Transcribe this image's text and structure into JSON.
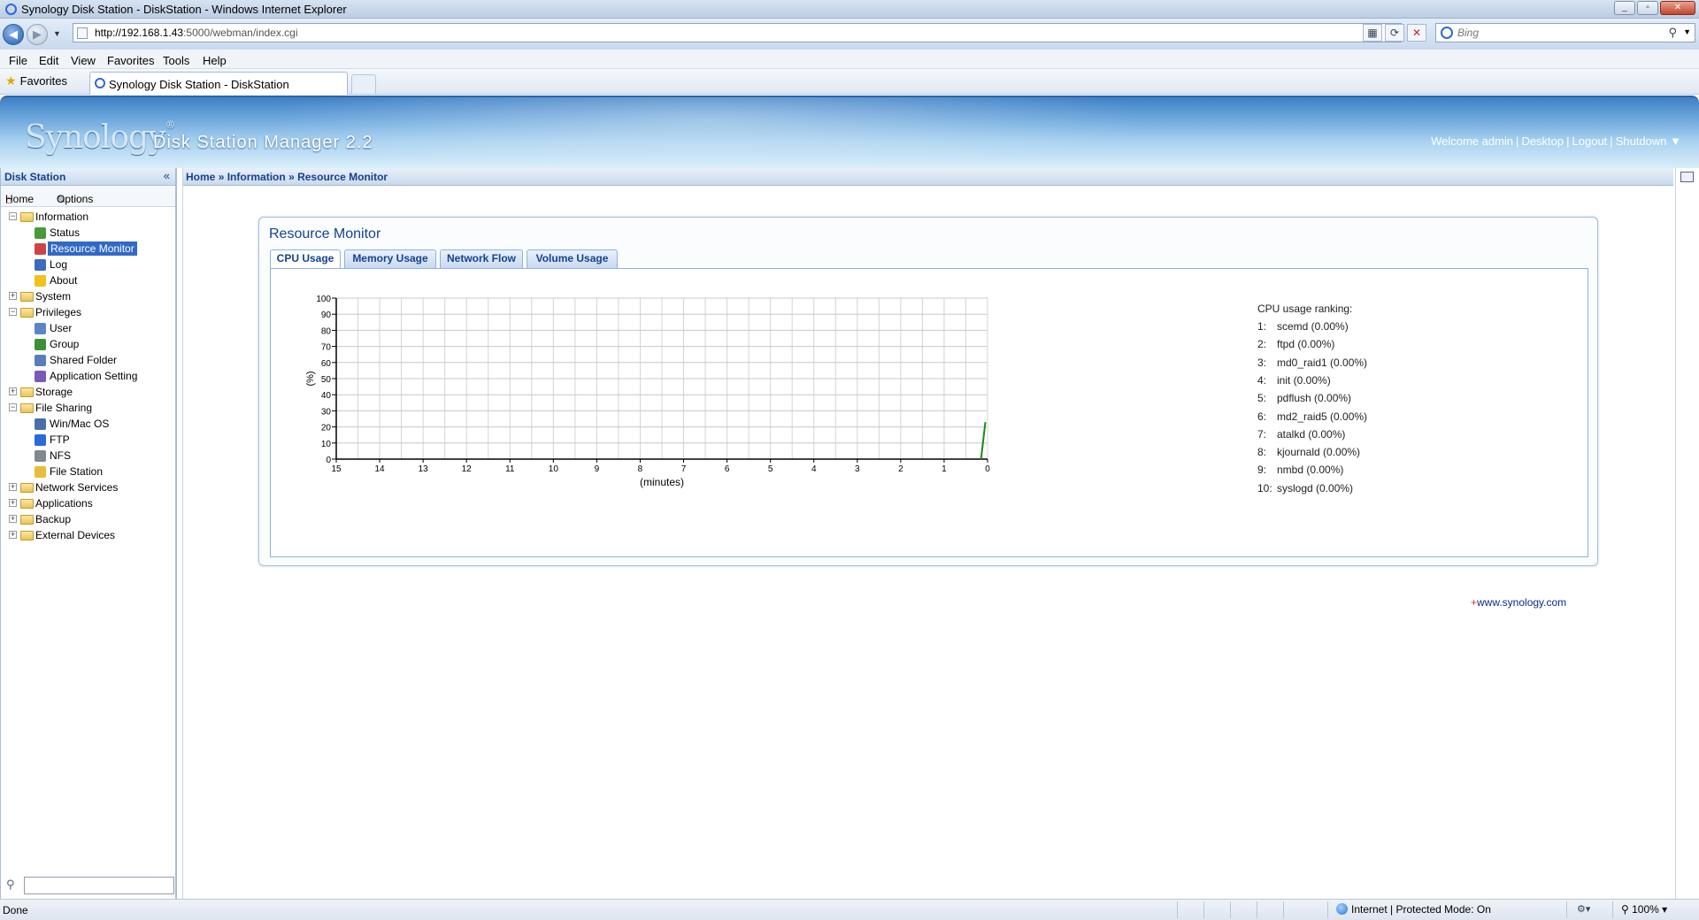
{
  "window": {
    "title": "Synology Disk Station - DiskStation - Windows Internet Explorer"
  },
  "browser": {
    "url_host": "http://192.168.1.43",
    "url_rest": ":5000/webman/index.cgi",
    "search_placeholder": "Bing",
    "menu": [
      "File",
      "Edit",
      "View",
      "Favorites",
      "Tools",
      "Help"
    ],
    "favorites_label": "Favorites",
    "tab_title": "Synology Disk Station - DiskStation"
  },
  "header": {
    "logo": "Synology",
    "product": "Disk Station Manager 2.2",
    "welcome": "Welcome admin",
    "desktop": "Desktop",
    "logout": "Logout",
    "shutdown": "Shutdown ▼"
  },
  "sidebar": {
    "title": "Disk Station",
    "home": "Home",
    "options": "Options",
    "tree": [
      {
        "label": "Information",
        "kind": "folder",
        "expanded": true
      },
      {
        "label": "Status",
        "kind": "child",
        "icon": "status-icon",
        "color": "#4a9a3a"
      },
      {
        "label": "Resource Monitor",
        "kind": "child",
        "icon": "resource-monitor-icon",
        "color": "#c44",
        "selected": true
      },
      {
        "label": "Log",
        "kind": "child",
        "icon": "log-icon",
        "color": "#3a6bbd"
      },
      {
        "label": "About",
        "kind": "child",
        "icon": "about-bulb-icon",
        "color": "#f2c11b"
      },
      {
        "label": "System",
        "kind": "folder",
        "expanded": false
      },
      {
        "label": "Privileges",
        "kind": "folder",
        "expanded": true
      },
      {
        "label": "User",
        "kind": "child",
        "icon": "user-icon",
        "color": "#5a86c8"
      },
      {
        "label": "Group",
        "kind": "child",
        "icon": "group-icon",
        "color": "#3f8f3a"
      },
      {
        "label": "Shared Folder",
        "kind": "child",
        "icon": "shared-folder-icon",
        "color": "#5a7fb8"
      },
      {
        "label": "Application Setting",
        "kind": "child",
        "icon": "application-setting-icon",
        "color": "#7a5ab8"
      },
      {
        "label": "Storage",
        "kind": "folder",
        "expanded": false
      },
      {
        "label": "File Sharing",
        "kind": "folder",
        "expanded": true
      },
      {
        "label": "Win/Mac OS",
        "kind": "child",
        "icon": "win-mac-icon",
        "color": "#4c6ea8"
      },
      {
        "label": "FTP",
        "kind": "child",
        "icon": "ftp-icon",
        "color": "#2a6bd6"
      },
      {
        "label": "NFS",
        "kind": "child",
        "icon": "nfs-icon",
        "color": "#808890"
      },
      {
        "label": "File Station",
        "kind": "child",
        "icon": "file-station-icon",
        "color": "#e8bd3c"
      },
      {
        "label": "Network Services",
        "kind": "folder",
        "expanded": false
      },
      {
        "label": "Applications",
        "kind": "folder",
        "expanded": false
      },
      {
        "label": "Backup",
        "kind": "folder",
        "expanded": false
      },
      {
        "label": "External Devices",
        "kind": "folder",
        "expanded": false
      }
    ]
  },
  "breadcrumb": {
    "home": "Home",
    "sep": "»",
    "info": "Information",
    "current": "Resource Monitor"
  },
  "panel": {
    "title": "Resource Monitor",
    "tabs": [
      "CPU Usage",
      "Memory Usage",
      "Network Flow",
      "Volume Usage"
    ],
    "active_tab": "CPU Usage"
  },
  "chart_data": {
    "type": "line",
    "xlabel": "(minutes)",
    "ylabel": "(%)",
    "x_ticks": [
      15,
      14,
      13,
      12,
      11,
      10,
      9,
      8,
      7,
      6,
      5,
      4,
      3,
      2,
      1,
      0
    ],
    "y_ticks": [
      0,
      10,
      20,
      30,
      40,
      50,
      60,
      70,
      80,
      90,
      100
    ],
    "xlim": [
      15,
      0
    ],
    "ylim": [
      0,
      100
    ],
    "grid": true,
    "series": [
      {
        "color": "#1a8a1a",
        "points": [
          {
            "x": 0.15,
            "y": 0
          },
          {
            "x": 0.05,
            "y": 23
          }
        ]
      }
    ]
  },
  "ranking": {
    "title": "CPU usage ranking:",
    "items": [
      {
        "rank": "1:",
        "text": "scemd (0.00%)"
      },
      {
        "rank": "2:",
        "text": "ftpd (0.00%)"
      },
      {
        "rank": "3:",
        "text": "md0_raid1 (0.00%)"
      },
      {
        "rank": "4:",
        "text": "init (0.00%)"
      },
      {
        "rank": "5:",
        "text": "pdflush (0.00%)"
      },
      {
        "rank": "6:",
        "text": "md2_raid5 (0.00%)"
      },
      {
        "rank": "7:",
        "text": "atalkd (0.00%)"
      },
      {
        "rank": "8:",
        "text": "kjournald (0.00%)"
      },
      {
        "rank": "9:",
        "text": "nmbd (0.00%)"
      },
      {
        "rank": "10:",
        "text": "syslogd (0.00%)"
      }
    ]
  },
  "footer_link": {
    "plus": "+",
    "text": "www.synology.com"
  },
  "statusbar": {
    "left": "Done",
    "zone": "Internet | Protected Mode: On",
    "zoom": "100%"
  }
}
